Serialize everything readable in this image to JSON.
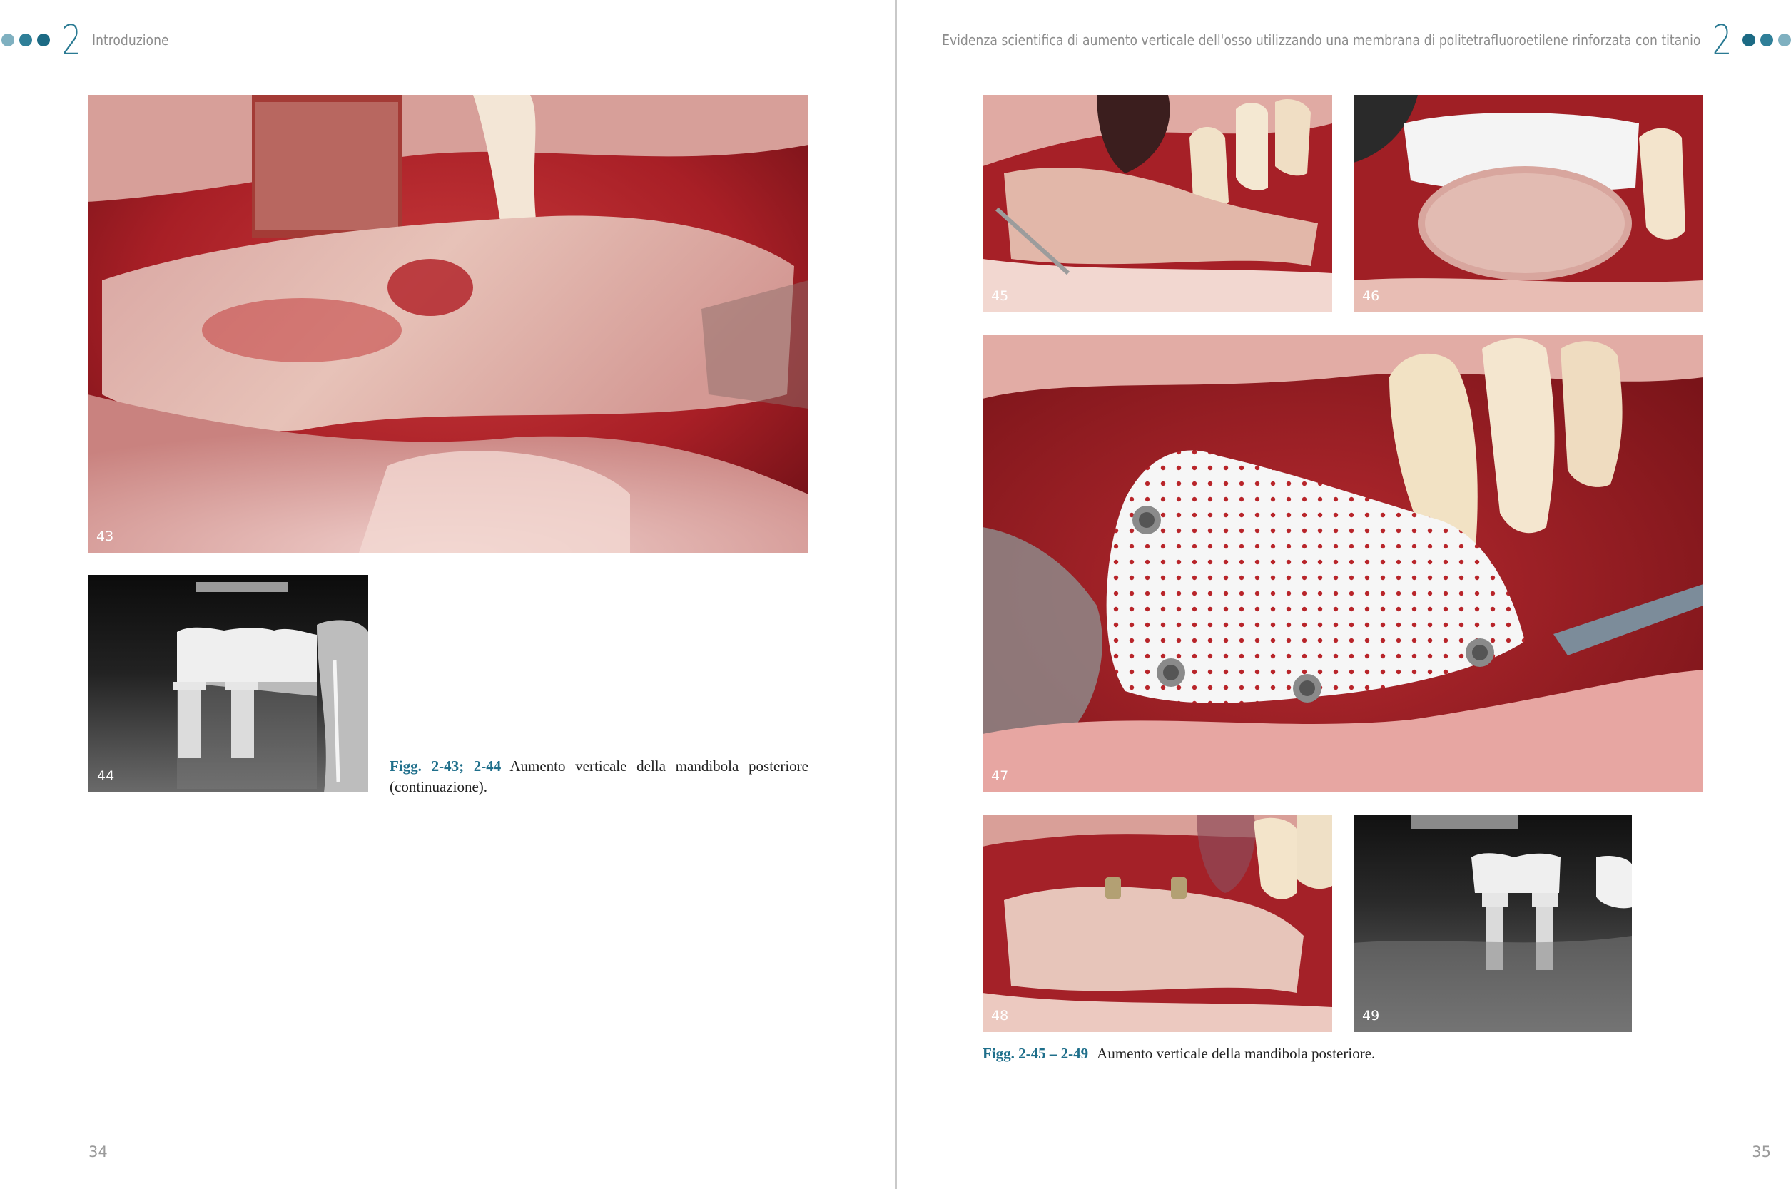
{
  "left_page": {
    "chapter_number": "2",
    "running_head": "Introduzione",
    "page_number": "34",
    "figures": [
      {
        "number": "43",
        "kind": "clinical-photo"
      },
      {
        "number": "44",
        "kind": "radiograph"
      }
    ],
    "caption": {
      "label": "Figg. 2-43; 2-44",
      "text": "Aumento verticale della mandibola posteriore (continuazione)."
    }
  },
  "right_page": {
    "chapter_number": "2",
    "running_head": "Evidenza scientifica di aumento verticale dell'osso utilizzando una membrana di politetrafluoroetilene rinforzata con titanio",
    "page_number": "35",
    "figures": [
      {
        "number": "45",
        "kind": "clinical-photo"
      },
      {
        "number": "46",
        "kind": "clinical-photo"
      },
      {
        "number": "47",
        "kind": "clinical-photo"
      },
      {
        "number": "48",
        "kind": "clinical-photo"
      },
      {
        "number": "49",
        "kind": "radiograph"
      }
    ],
    "caption": {
      "label": "Figg. 2-45 – 2-49",
      "text": "Aumento verticale della mandibola posteriore."
    }
  },
  "colors": {
    "accent": "#1f6f8b",
    "dot_light": "#7fb0c0",
    "dot_dark": "#1c6a84"
  }
}
